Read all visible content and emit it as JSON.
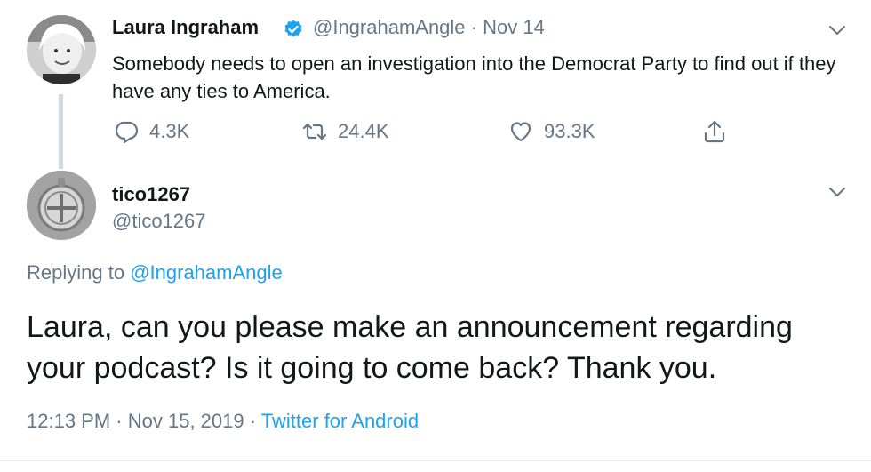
{
  "parent_tweet": {
    "author_name": "Laura Ingraham",
    "handle": "@IngrahamAngle",
    "separator": "·",
    "date": "Nov 14",
    "text": "Somebody needs to open an investigation into the Democrat Party to find out if they have any ties to America.",
    "reply_count": "4.3K",
    "retweet_count": "24.4K",
    "like_count": "93.3K"
  },
  "reply_tweet": {
    "author_name": "tico1267",
    "handle": "@tico1267",
    "replying_prefix": "Replying to",
    "replying_handle": "@IngrahamAngle",
    "text": "Laura, can you please make an announcement regarding your podcast?  Is it going to come back?  Thank you.",
    "time": "12:13 PM",
    "separator": "·",
    "date": "Nov 15, 2019",
    "source": "Twitter for Android"
  },
  "icons": {
    "verified": "verified-badge-icon",
    "reply": "reply-icon",
    "retweet": "retweet-icon",
    "like": "heart-icon",
    "share": "share-icon",
    "more": "chevron-down-icon"
  },
  "colors": {
    "link": "#1da1f2",
    "secondary_text": "#657786",
    "primary_text": "#14171a",
    "thread_line": "#cfd9de"
  }
}
